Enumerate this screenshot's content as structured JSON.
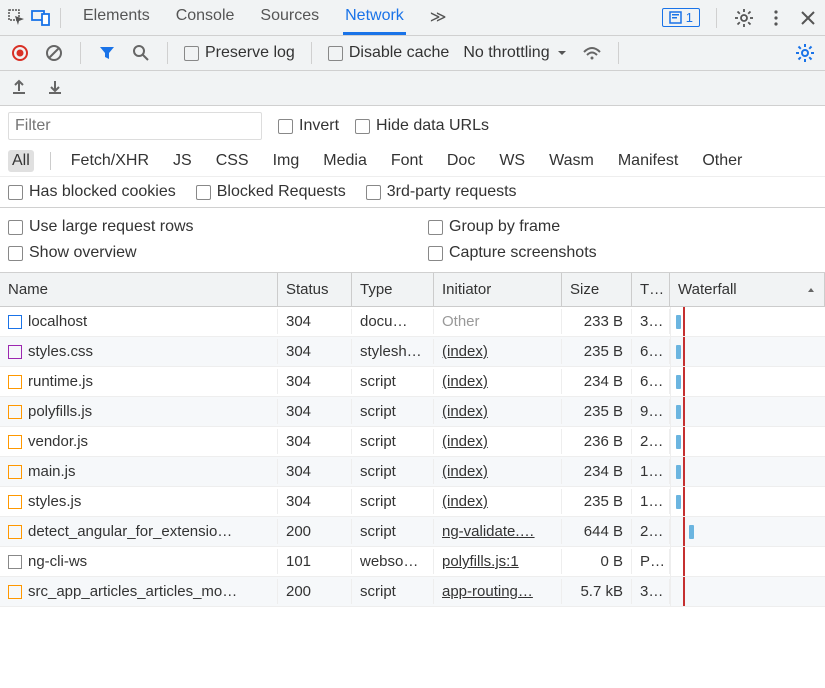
{
  "tabs": {
    "elements": "Elements",
    "console": "Console",
    "sources": "Sources",
    "network": "Network",
    "more": "≫"
  },
  "badge_count": "1",
  "toolbar": {
    "preserve_log": "Preserve log",
    "disable_cache": "Disable cache",
    "throttling": "No throttling"
  },
  "filter": {
    "placeholder": "Filter",
    "invert": "Invert",
    "hide_data_urls": "Hide data URLs",
    "types": [
      "All",
      "Fetch/XHR",
      "JS",
      "CSS",
      "Img",
      "Media",
      "Font",
      "Doc",
      "WS",
      "Wasm",
      "Manifest",
      "Other"
    ],
    "has_blocked": "Has blocked cookies",
    "blocked_req": "Blocked Requests",
    "third_party": "3rd-party requests"
  },
  "options": {
    "large_rows": "Use large request rows",
    "group_frame": "Group by frame",
    "show_overview": "Show overview",
    "capture_ss": "Capture screenshots"
  },
  "columns": {
    "name": "Name",
    "status": "Status",
    "type": "Type",
    "initiator": "Initiator",
    "size": "Size",
    "time": "T…",
    "waterfall": "Waterfall"
  },
  "rows": [
    {
      "icon": "doc",
      "name": "localhost",
      "status": "304",
      "type": "docu…",
      "initiator": "Other",
      "initiator_link": false,
      "size": "233 B",
      "time": "3…",
      "wf": 5
    },
    {
      "icon": "css",
      "name": "styles.css",
      "status": "304",
      "type": "stylesh…",
      "initiator": "(index)",
      "initiator_link": true,
      "size": "235 B",
      "time": "6…",
      "wf": 5
    },
    {
      "icon": "js",
      "name": "runtime.js",
      "status": "304",
      "type": "script",
      "initiator": "(index)",
      "initiator_link": true,
      "size": "234 B",
      "time": "6…",
      "wf": 5
    },
    {
      "icon": "js",
      "name": "polyfills.js",
      "status": "304",
      "type": "script",
      "initiator": "(index)",
      "initiator_link": true,
      "size": "235 B",
      "time": "9…",
      "wf": 5
    },
    {
      "icon": "js",
      "name": "vendor.js",
      "status": "304",
      "type": "script",
      "initiator": "(index)",
      "initiator_link": true,
      "size": "236 B",
      "time": "2…",
      "wf": 5
    },
    {
      "icon": "js",
      "name": "main.js",
      "status": "304",
      "type": "script",
      "initiator": "(index)",
      "initiator_link": true,
      "size": "234 B",
      "time": "1…",
      "wf": 5
    },
    {
      "icon": "js",
      "name": "styles.js",
      "status": "304",
      "type": "script",
      "initiator": "(index)",
      "initiator_link": true,
      "size": "235 B",
      "time": "1…",
      "wf": 5
    },
    {
      "icon": "js",
      "name": "detect_angular_for_extensio…",
      "status": "200",
      "type": "script",
      "initiator": "ng-validate.…",
      "initiator_link": true,
      "size": "644 B",
      "time": "2…",
      "wf": 18
    },
    {
      "icon": "ws",
      "name": "ng-cli-ws",
      "status": "101",
      "type": "webso…",
      "initiator": "polyfills.js:1",
      "initiator_link": true,
      "size": "0 B",
      "time": "P…",
      "wf": null
    },
    {
      "icon": "js",
      "name": "src_app_articles_articles_mo…",
      "status": "200",
      "type": "script",
      "initiator": "app-routing…",
      "initiator_link": true,
      "size": "5.7 kB",
      "time": "3…",
      "wf": null
    }
  ]
}
